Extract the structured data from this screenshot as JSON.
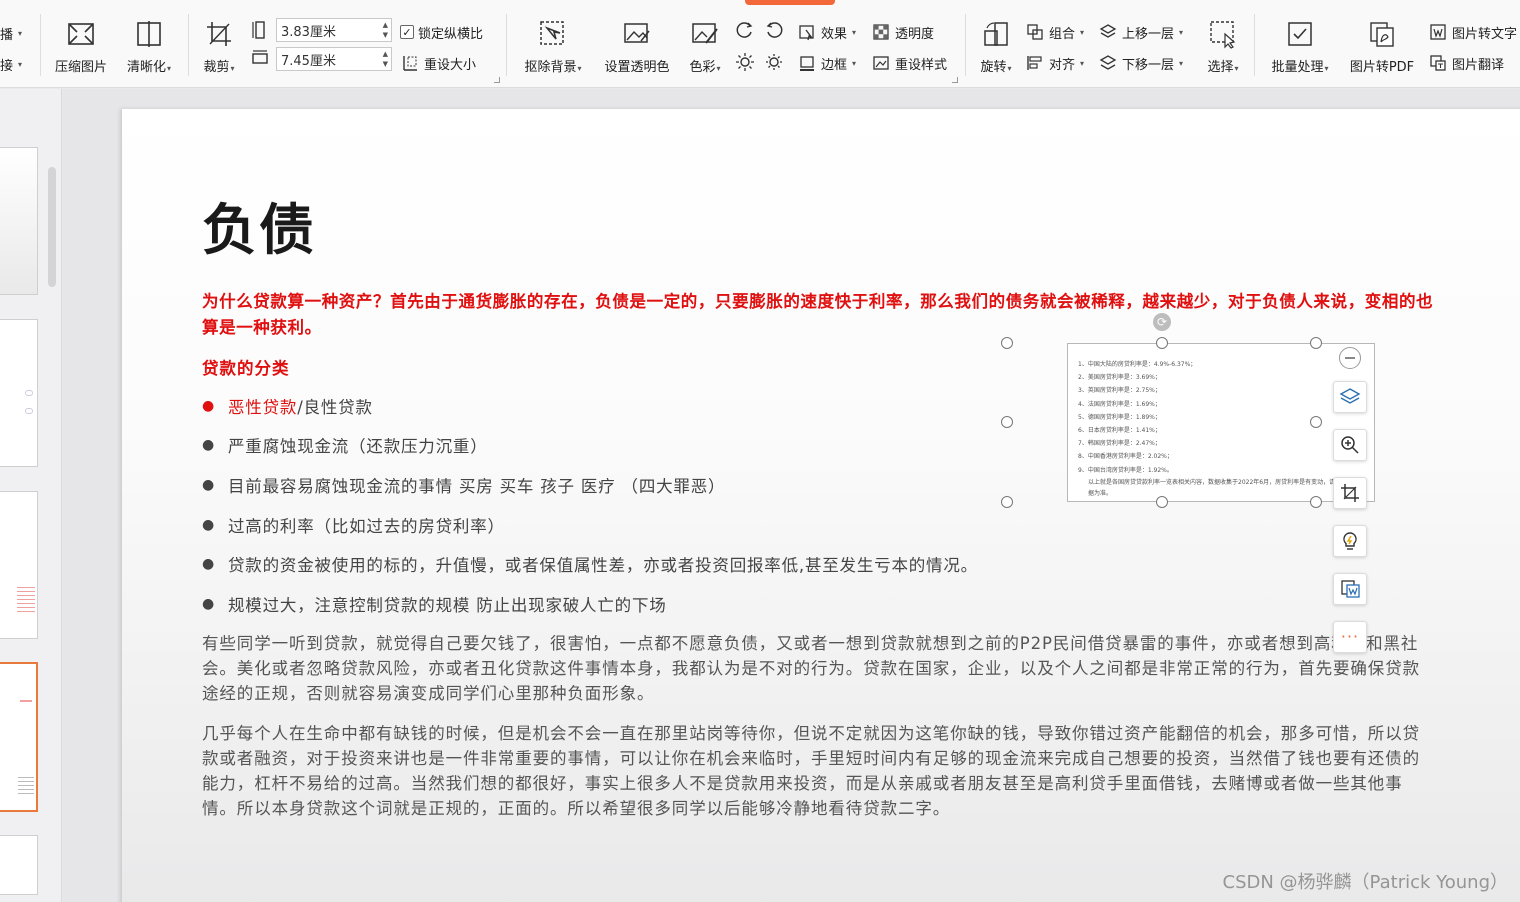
{
  "ribbon": {
    "left_cut_1": "播",
    "left_cut_2": "接",
    "compress": "压缩图片",
    "sharpen": "清晰化",
    "crop": "裁剪",
    "width_value": "3.83厘米",
    "height_value": "7.45厘米",
    "lock_ratio": "锁定纵横比",
    "reset_size": "重设大小",
    "remove_bg": "抠除背景",
    "set_transparent": "设置透明色",
    "color": "色彩",
    "effects": "效果",
    "transparency": "透明度",
    "border": "边框",
    "reset_style": "重设样式",
    "rotate": "旋转",
    "group": "组合",
    "align": "对齐",
    "bring_forward": "上移一层",
    "send_backward": "下移一层",
    "select": "选择",
    "batch": "批量处理",
    "to_pdf": "图片转PDF",
    "to_text": "图片转文字",
    "translate": "图片翻译"
  },
  "slide": {
    "title": "负债",
    "red_para": "为什么贷款算一种资产？首先由于通货膨胀的存在，负债是一定的，只要膨胀的速度快于利率，那么我们的债务就会被稀释，越来越少，对于负债人来说，变相的也算是一种获利。",
    "subhead": "贷款的分类",
    "bullets": [
      {
        "hl": "恶性贷款",
        "rest": "/良性贷款"
      },
      {
        "hl": "",
        "rest": "严重腐蚀现金流（还款压力沉重）"
      },
      {
        "hl": "",
        "rest": "目前最容易腐蚀现金流的事情 买房 买车 孩子 医疗 （四大罪恶）"
      },
      {
        "hl": "",
        "rest": "过高的利率（比如过去的房贷利率）"
      },
      {
        "hl": "",
        "rest": "贷款的资金被使用的标的，升值慢，或者保值属性差，亦或者投资回报率低,甚至发生亏本的情况。"
      },
      {
        "hl": "",
        "rest": "规模过大，注意控制贷款的规模 防止出现家破人亡的下场"
      }
    ],
    "para1": "有些同学一听到贷款，就觉得自己要欠钱了，很害怕，一点都不愿意负债，又或者一想到贷款就想到之前的P2P民间借贷暴雷的事件，亦或者想到高利贷和黑社会。美化或者忽略贷款风险，亦或者丑化贷款这件事情本身，我都认为是不对的行为。贷款在国家，企业，以及个人之间都是非常正常的行为，首先要确保贷款途经的正规，否则就容易演变成同学们心里那种负面形象。",
    "para2": "几乎每个人在生命中都有缺钱的时候，但是机会不会一直在那里站岗等待你，但说不定就因为这笔你缺的钱，导致你错过资产能翻倍的机会，那多可惜，所以贷款或者融资，对于投资来讲也是一件非常重要的事情，可以让你在机会来临时，手里短时间内有足够的现金流来完成自己想要的投资，当然借了钱也要有还债的能力，杠杆不易给的过高。当然我们想的都很好，事实上很多人不是贷款用来投资，而是从亲戚或者朋友甚至是高利贷手里面借钱，去赌博或者做一些其他事情。所以本身贷款这个词就是正规的，正面的。所以希望很多同学以后能够冷静地看待贷款二字。"
  },
  "picture": {
    "lines": [
      "1、中国大陆的房贷利率是：4.9%-6.37%；",
      "2、美国房贷利率是：3.69%；",
      "3、英国房贷利率是：2.75%；",
      "4、法国房贷利率是：1.69%；",
      "5、德国房贷利率是：1.89%；",
      "6、日本房贷利率是：1.41%；",
      "7、韩国房贷利率是：2.47%；",
      "8、中国香港房贷利率是：2.02%；",
      "9、中国台湾房贷利率是：1.92%。"
    ],
    "note": "以上就是各国房贷贷款利率一览表相关内容，数据收集于2022年6月，房贷利率是有变动，请以最新数据为准。"
  },
  "watermark": "CSDN @杨骅麟（Patrick Young）",
  "colors": {
    "accent": "#f2683b",
    "red_text": "#e01010",
    "selected_thumb": "#ea7a3c"
  }
}
